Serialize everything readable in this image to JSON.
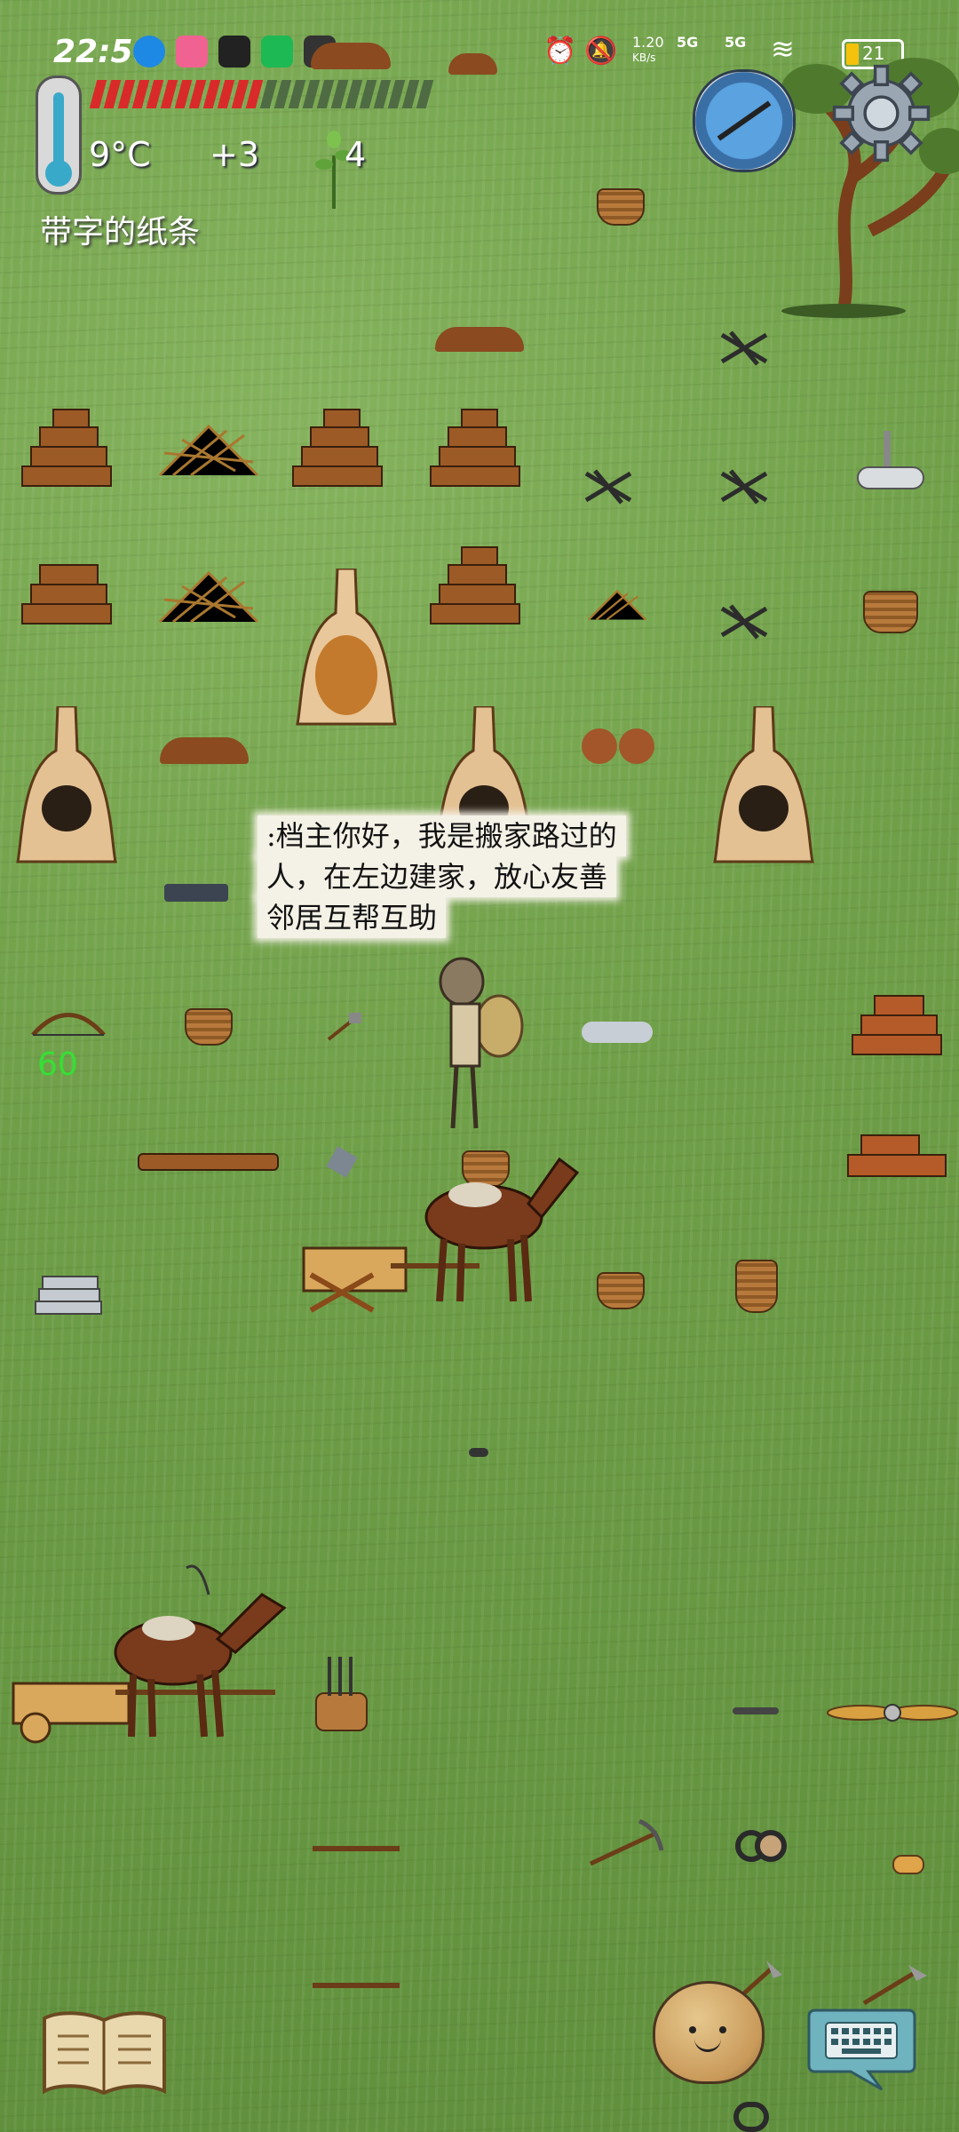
{
  "status_bar": {
    "time": "22:50",
    "net_speed": "1.20",
    "net_unit": "KB/s",
    "signal1": "5G",
    "signal2": "5G",
    "battery": "21"
  },
  "hud": {
    "temperature": "9°C",
    "food_bonus": "+3",
    "yum_count": "4",
    "held_item": "带字的纸条",
    "health_filled": 12,
    "health_total": 24
  },
  "speech": {
    "lines": [
      ":档主你好，我是搬家路过的",
      "人，在左边建家，放心友善",
      "邻居互帮互助"
    ]
  },
  "world": {
    "item_counter": "60"
  },
  "colors": {
    "health_red": "#d92a2a",
    "health_empty": "#4f6b43",
    "grass": "#6f9f48"
  },
  "icons": [
    "thermometer-icon",
    "sapling-icon",
    "compass-icon",
    "settings-gear-icon",
    "recipe-book-icon",
    "emote-potato-icon",
    "keyboard-chat-icon"
  ]
}
